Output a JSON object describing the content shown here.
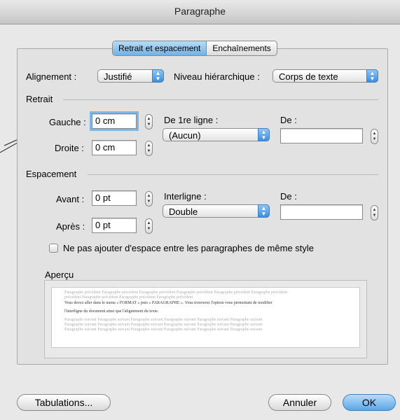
{
  "window": {
    "title": "Paragraphe"
  },
  "tabs": [
    {
      "label": "Retrait et espacement",
      "selected": true
    },
    {
      "label": "Enchaînements",
      "selected": false
    }
  ],
  "alignment": {
    "label": "Alignement :",
    "value": "Justifié"
  },
  "outline_level": {
    "label": "Niveau hiérarchique :",
    "value": "Corps de texte"
  },
  "indent": {
    "section_label": "Retrait",
    "left": {
      "label": "Gauche :",
      "value": "0 cm"
    },
    "right": {
      "label": "Droite :",
      "value": "0 cm"
    },
    "first_line": {
      "label": "De 1re ligne :",
      "value": "(Aucun)"
    },
    "by": {
      "label": "De :",
      "value": ""
    }
  },
  "spacing": {
    "section_label": "Espacement",
    "before": {
      "label": "Avant :",
      "value": "0 pt"
    },
    "after": {
      "label": "Après :",
      "value": "0 pt"
    },
    "line_spacing": {
      "label": "Interligne :",
      "value": "Double"
    },
    "at": {
      "label": "De :",
      "value": ""
    }
  },
  "no_space_checkbox": {
    "label": "Ne pas ajouter d'espace entre les paragraphes de même style",
    "checked": false
  },
  "preview": {
    "label": "Aperçu",
    "prev_line1": "Paragraphe précédent Paragraphe précédent Paragraphe précédent Paragraphe précédent Paragraphe précédent Paragraphe précédent",
    "prev_line2": "précédent Paragraphe précédent Paragraphe précédent Paragraphe précédent",
    "text_line1": "Vous devez aller dans le menu « FORMAT » puis « PARAGRAPHE ». Vous trouverez l'option vous permettant de modifier",
    "text_line2": "l'interligne du document ainsi que l'alignement du texte.",
    "next_line1": "Paragraphe suivant Paragraphe suivant Paragraphe suivant Paragraphe suivant Paragraphe suivant Paragraphe suivant",
    "next_line2": "Paragraphe suivant Paragraphe suivant Paragraphe suivant Paragraphe suivant Paragraphe suivant Paragraphe suivant",
    "next_line3": "Paragraphe suivant Paragraphe suivant Paragraphe suivant Paragraphe suivant Paragraphe suivant Paragraphe suivant"
  },
  "buttons": {
    "tabs": "Tabulations...",
    "cancel": "Annuler",
    "ok": "OK"
  }
}
